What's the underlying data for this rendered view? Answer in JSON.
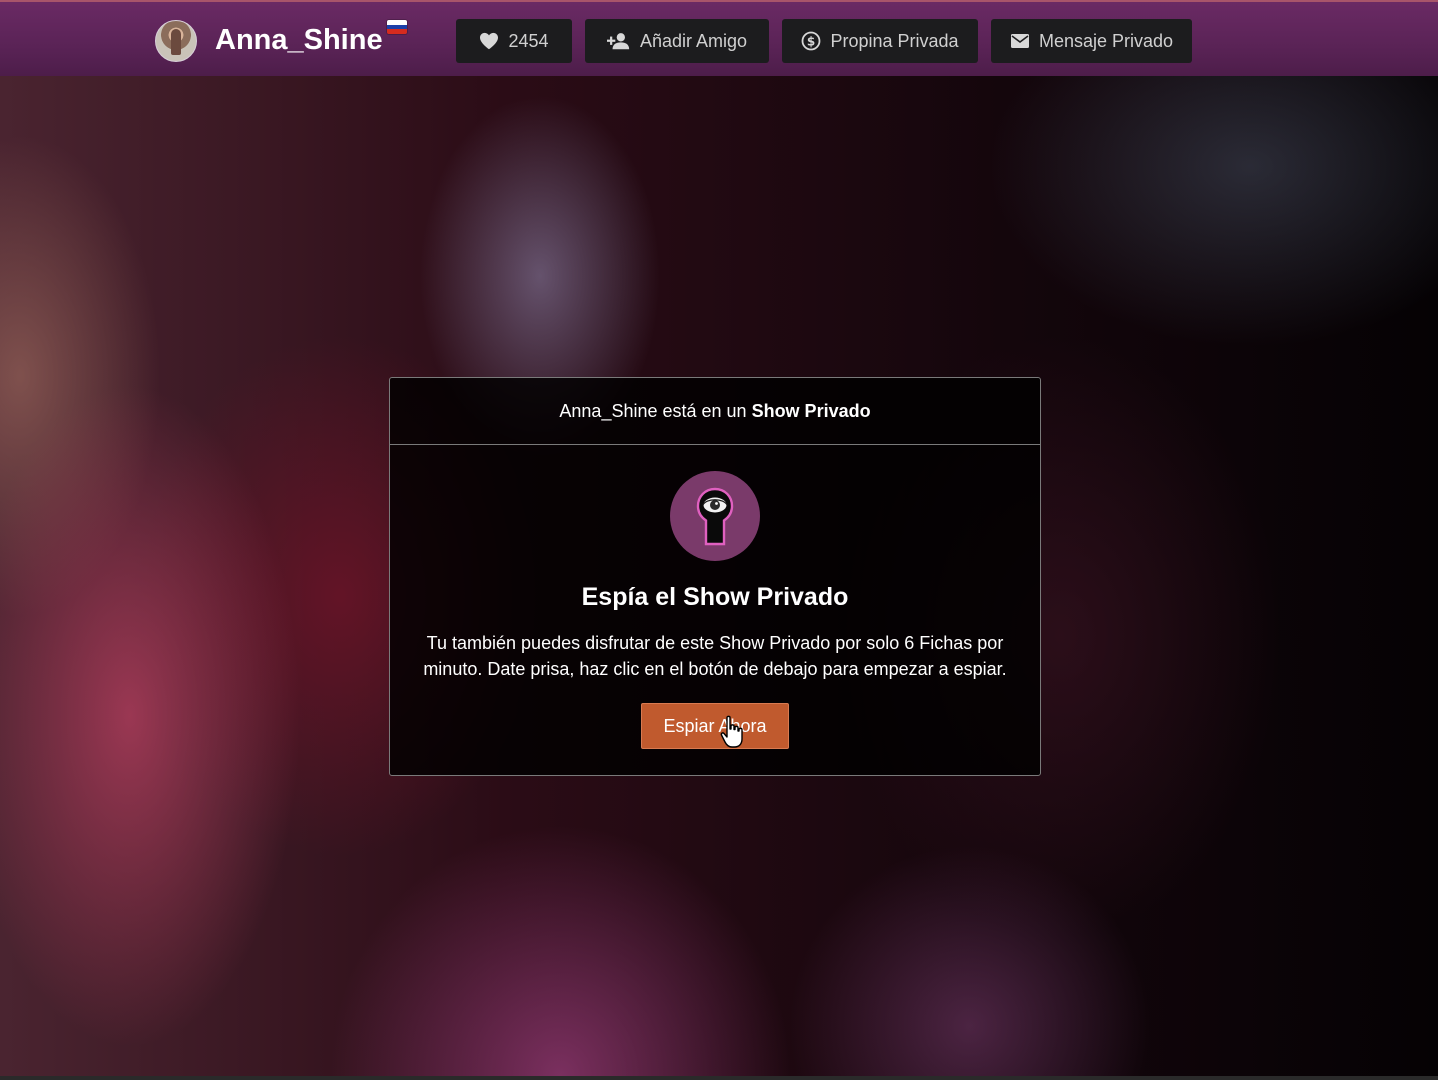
{
  "header": {
    "model_name": "Anna_Shine",
    "flag_country": "russia-flag-icon",
    "flag_colors": [
      "#ffffff",
      "#1c3fa8",
      "#d52b1e"
    ],
    "likes_count": "2454",
    "add_friend_label": "Añadir Amigo",
    "private_tip_label": "Propina Privada",
    "private_message_label": "Mensaje Privado",
    "background_color": "#5a2356",
    "button_color": "#1c1c1e"
  },
  "modal": {
    "status_prefix": "Anna_Shine está en un",
    "status_bold": "Show Privado",
    "title": "Espía el Show Privado",
    "description": "Tu también puedes disfrutar de este Show Privado por solo 6 Fichas por minuto. Date prisa, haz clic en el botón de debajo para empezar a espiar.",
    "button_label": "Espiar Ahora",
    "button_color": "#c05a2e",
    "icon": "keyhole-eye-icon",
    "icon_color": "#7a3a6a"
  }
}
